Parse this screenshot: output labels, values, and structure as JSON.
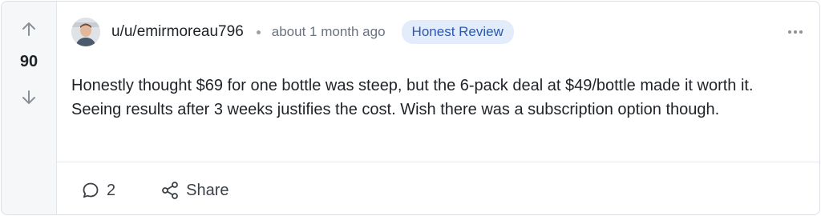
{
  "post": {
    "votes": "90",
    "username": "u/u/emirmoreau796",
    "timestamp": "about 1 month ago",
    "badge": "Honest Review",
    "body": "Honestly thought $69 for one bottle was steep, but the 6-pack deal at $49/bottle made it worth it. Seeing results after 3 weeks justifies the cost. Wish there was a subscription option though.",
    "comments_count": "2",
    "share_label": "Share"
  },
  "colors": {
    "badge_bg": "#e3ecfb",
    "badge_text": "#2b58b0",
    "vote_column_bg": "#f6f7f8"
  },
  "icons": [
    "arrow-up-icon",
    "arrow-down-icon",
    "comment-icon",
    "share-icon",
    "more-options-icon"
  ]
}
